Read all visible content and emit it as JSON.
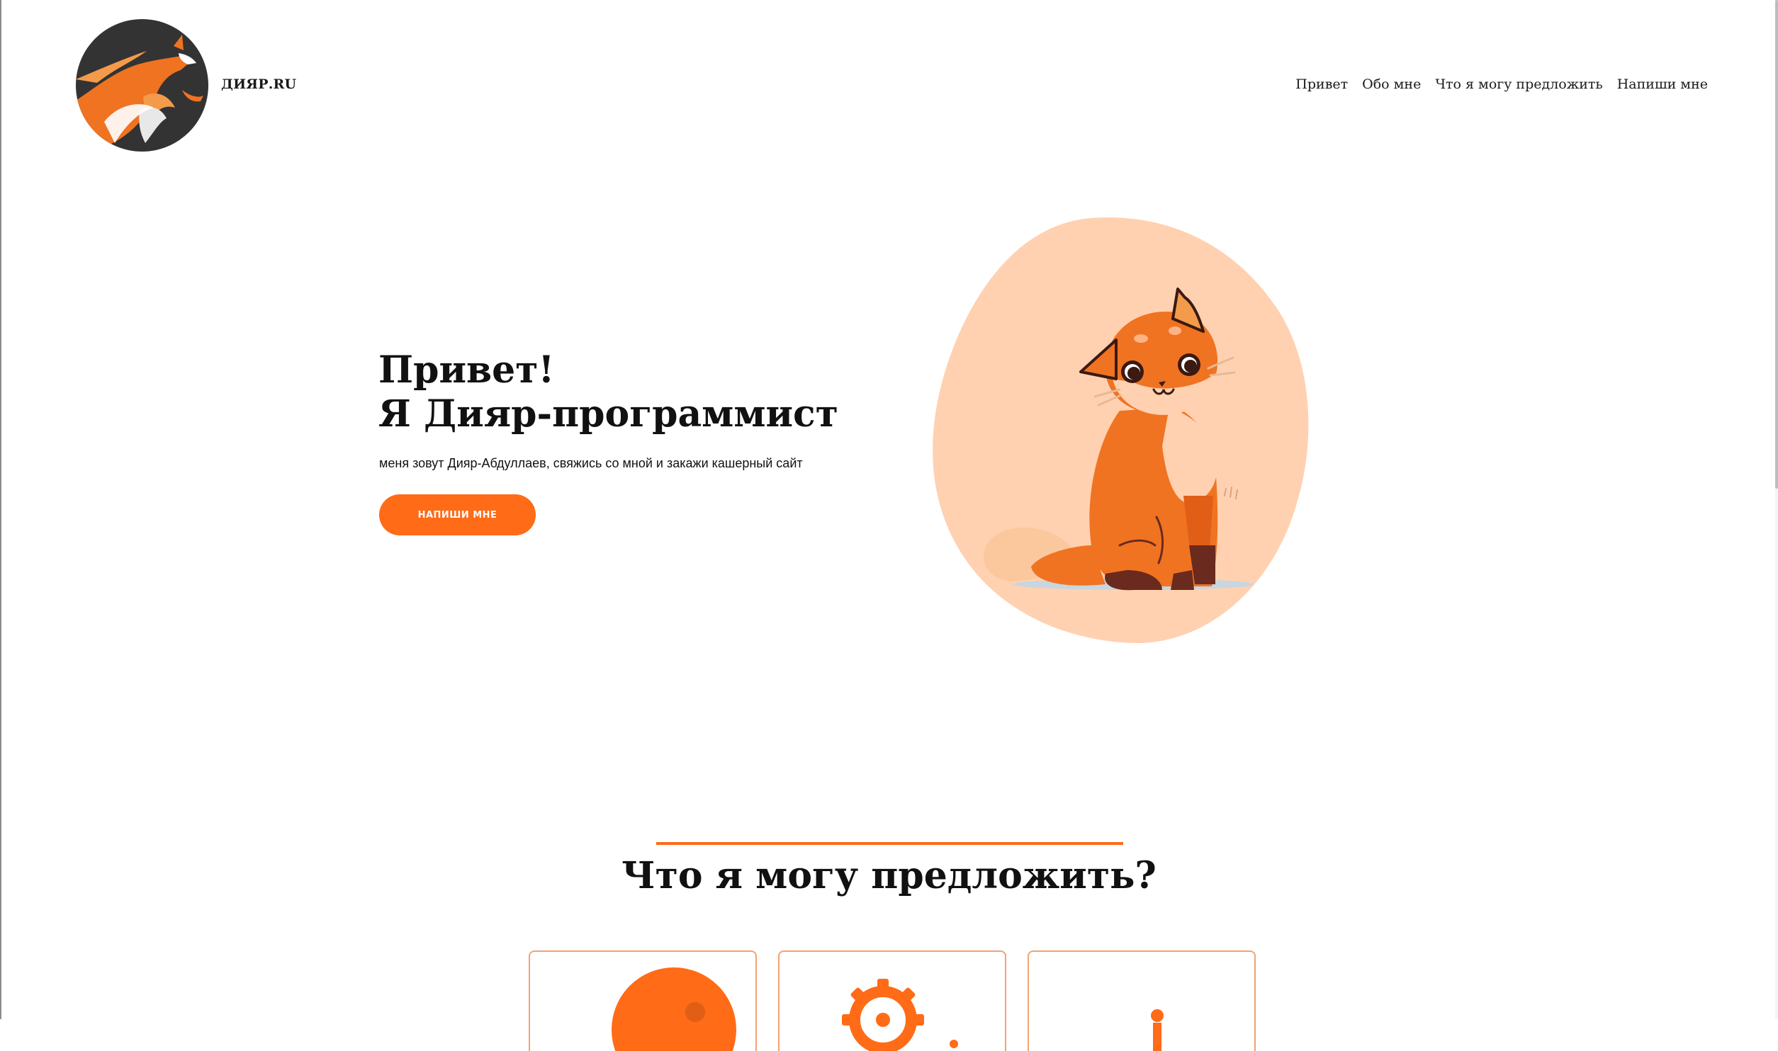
{
  "header": {
    "brand": "ДИЯР.RU",
    "nav": [
      "Привет",
      "Обо мне",
      "Что я могу предложить",
      "Напиши мне"
    ]
  },
  "hero": {
    "title_line1": "Привет!",
    "title_line2": "Я Дияр-программист",
    "subtitle": "меня зовут Дияр-Абдуллаев, свяжись со мной и закажи кашерный сайт",
    "button": "НАПИШИ МНЕ"
  },
  "services": {
    "title": "Что я могу предложить?",
    "cards": [
      {
        "icon": "circle-icon"
      },
      {
        "icon": "gear-icon"
      },
      {
        "icon": "person-icon"
      }
    ]
  },
  "colors": {
    "accent": "#ff6b17",
    "blob": "#ffd1b0",
    "logo_bg": "#333333",
    "card_border": "#f2a374"
  }
}
